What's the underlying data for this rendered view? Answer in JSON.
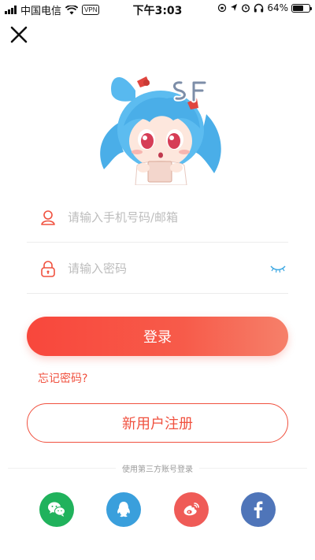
{
  "status_bar": {
    "carrier": "中国电信",
    "vpn": "VPN",
    "time": "下午3:03",
    "battery": "64%",
    "battery_level": 0.64
  },
  "icons": {
    "close": "close-icon",
    "user": "user-icon",
    "lock": "lock-icon",
    "eye": "eye-closed-icon",
    "wechat": "wechat-icon",
    "qq": "qq-icon",
    "weibo": "weibo-icon",
    "facebook": "facebook-icon"
  },
  "form": {
    "account_placeholder": "请输入手机号码/邮箱",
    "password_placeholder": "请输入密码",
    "login_label": "登录",
    "forgot_label": "忘记密码?",
    "register_label": "新用户注册"
  },
  "third_party": {
    "title": "使用第三方账号登录"
  },
  "colors": {
    "accent": "#f0513f",
    "wechat": "#20b25c",
    "qq": "#3a9fdc",
    "weibo": "#ef5b57",
    "facebook": "#4f75b9"
  }
}
